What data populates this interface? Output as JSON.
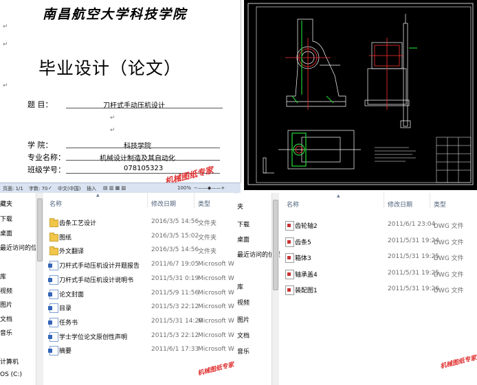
{
  "document": {
    "school_name": "南昌航空大学科技学院",
    "title": "毕业设计（论文）",
    "fields": [
      {
        "label": "题    目：",
        "value": "刀杆式手动压机设计"
      },
      {
        "label": "学    院：",
        "value": "科技学院"
      },
      {
        "label": "专业名称：",
        "value": "机械设计制造及其自动化"
      },
      {
        "label": "班级学号：",
        "value": "078105323"
      }
    ],
    "watermark": "机械图纸专家",
    "status_bar": {
      "page": "页面: 1/1",
      "words": "字数: 70",
      "language": "中文(中国)",
      "mode": "插入",
      "zoom": "100%"
    }
  },
  "explorer_left": {
    "nav_items": [
      "藏夹",
      "下载",
      "桌面",
      "最近访问的位置",
      "库",
      "视频",
      "图片",
      "文档",
      "音乐",
      "计算机",
      "OS (C:)"
    ],
    "columns": {
      "name": "名称",
      "date": "修改日期",
      "type": "类型"
    },
    "files": [
      {
        "name": "齿条工艺设计",
        "date": "2016/3/5 14:56",
        "type": "文件夹",
        "icon": "folder-icon"
      },
      {
        "name": "图纸",
        "date": "2016/3/5 15:02",
        "type": "文件夹",
        "icon": "folder-icon"
      },
      {
        "name": "外文翻译",
        "date": "2016/3/5 14:56",
        "type": "文件夹",
        "icon": "folder-icon"
      },
      {
        "name": "刀杆式手动压机设计开题报告",
        "date": "2011/6/7 19:05",
        "type": "Microsoft Word",
        "icon": "word-icon"
      },
      {
        "name": "刀杆式手动压机设计说明书",
        "date": "2011/5/31 0:19",
        "type": "Microsoft Word",
        "icon": "word-icon"
      },
      {
        "name": "论文封面",
        "date": "2011/5/9 11:56",
        "type": "Microsoft Word",
        "icon": "word-icon"
      },
      {
        "name": "目录",
        "date": "2011/5/3 22:12",
        "type": "Microsoft Word",
        "icon": "word-icon"
      },
      {
        "name": "任务书",
        "date": "2011/5/31 14:20",
        "type": "Microsoft Word",
        "icon": "word-icon"
      },
      {
        "name": "学士学位论文原创性声明",
        "date": "2011/5/3 22:12",
        "type": "Microsoft Word",
        "icon": "word-icon"
      },
      {
        "name": "摘要",
        "date": "2011/6/1 17:33",
        "type": "Microsoft Word",
        "icon": "word-icon"
      }
    ],
    "watermark": "机械图纸专家"
  },
  "explorer_right": {
    "nav_items": [
      "夹",
      "下载",
      "桌面",
      "最近访问的位置",
      "库",
      "视频",
      "图片",
      "文档",
      "音乐"
    ],
    "columns": {
      "name": "名称",
      "date": "修改日期",
      "type": "类型"
    },
    "files": [
      {
        "name": "齿轮轴2",
        "date": "2011/6/1 23:04",
        "type": "DWG 文件",
        "icon": "dwg-icon"
      },
      {
        "name": "齿条5",
        "date": "2011/5/31 19:24",
        "type": "DWG 文件",
        "icon": "dwg-icon"
      },
      {
        "name": "箱体3",
        "date": "2011/5/31 19:25",
        "type": "DWG 文件",
        "icon": "dwg-icon"
      },
      {
        "name": "轴承盖4",
        "date": "2011/5/31 19:25",
        "type": "DWG 文件",
        "icon": "dwg-icon"
      },
      {
        "name": "装配图1",
        "date": "2011/5/31 19:26",
        "type": "DWG 文件",
        "icon": "dwg-icon"
      }
    ],
    "watermark": "机械图纸专家"
  },
  "colors": {
    "cad_background": "#000000",
    "cad_lines": "#ffffff",
    "cad_accent_red": "#ff3030",
    "cad_accent_green": "#22cc33",
    "watermark": "#e03030",
    "header_text": "#4c607a"
  }
}
